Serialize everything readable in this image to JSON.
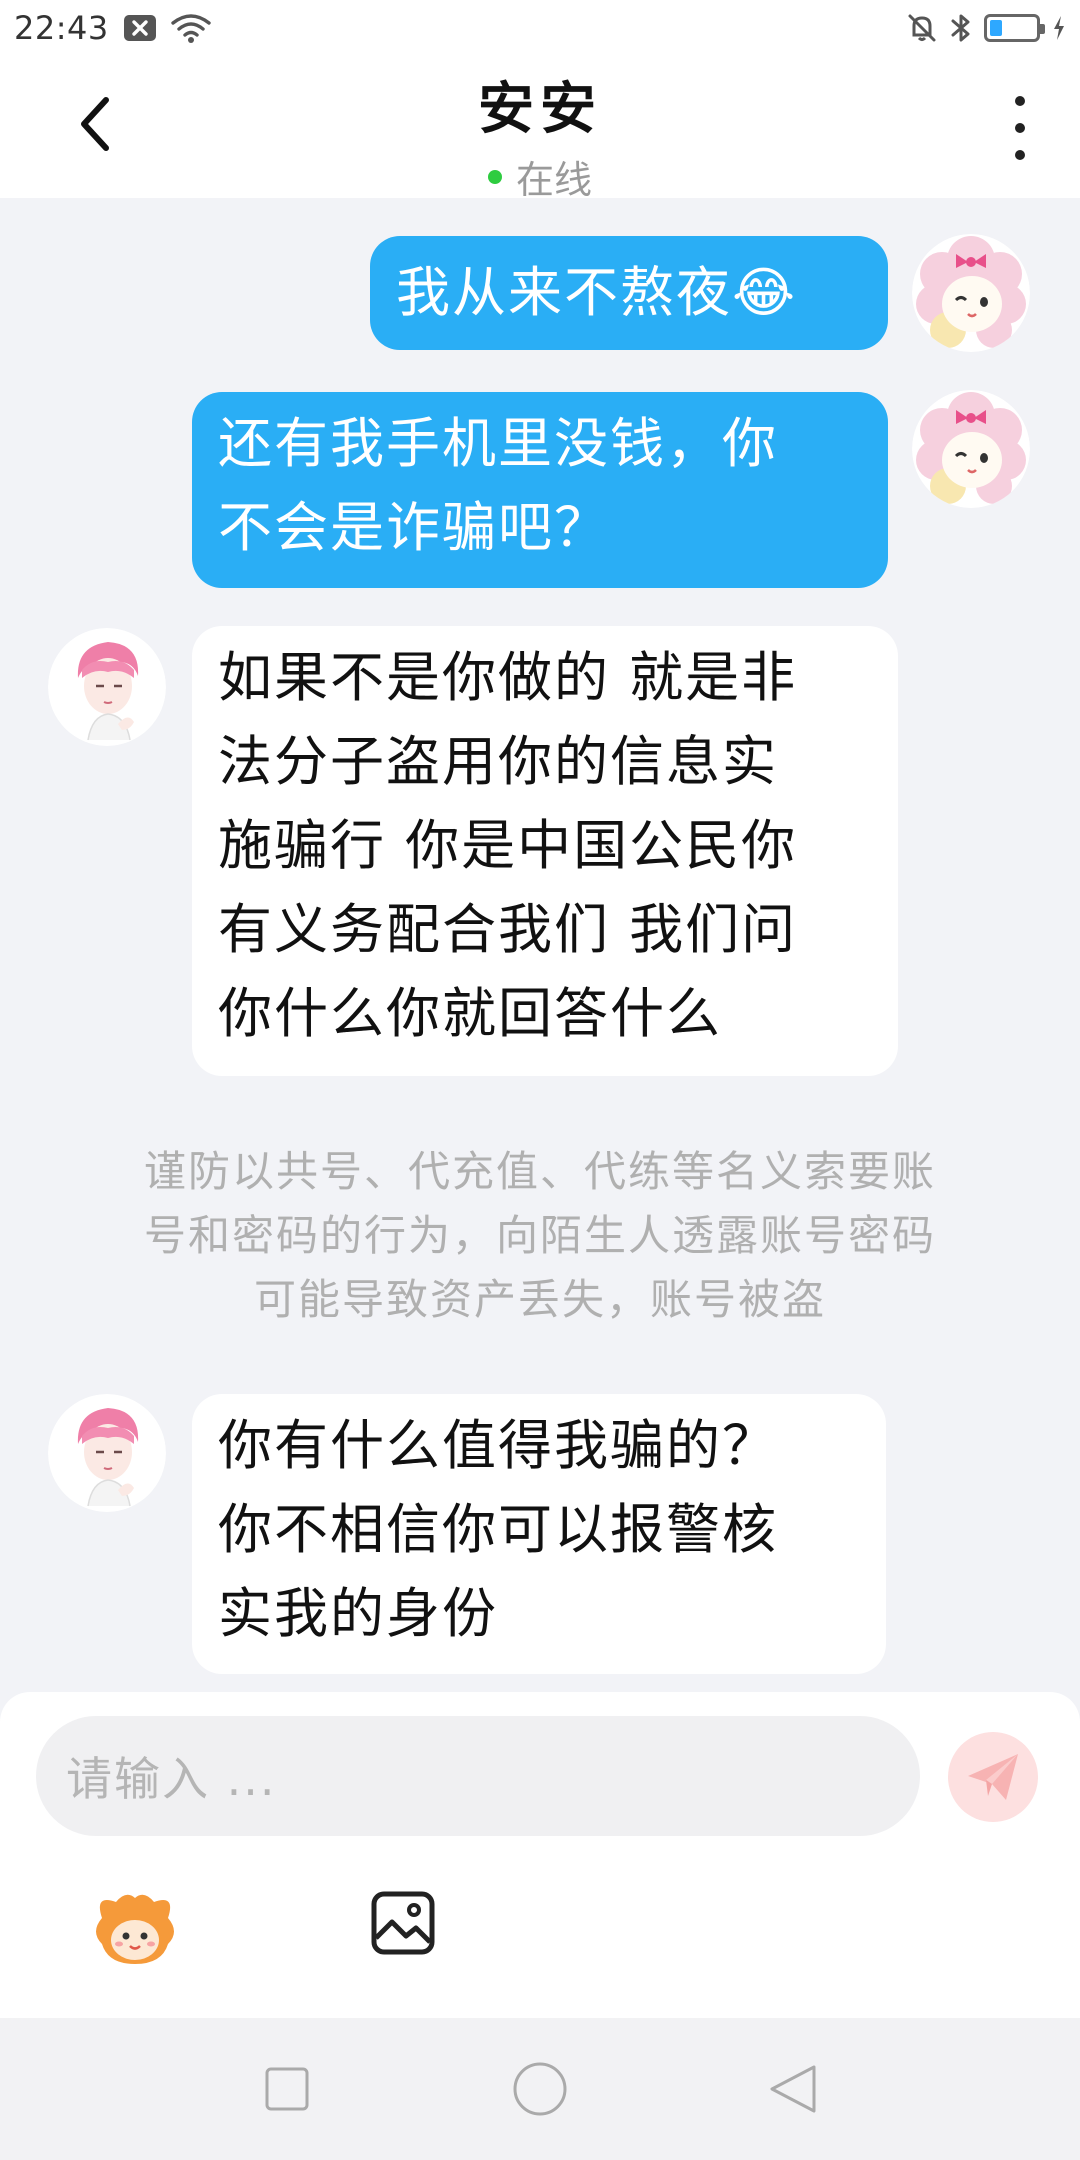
{
  "status_bar": {
    "time": "22:43"
  },
  "header": {
    "title": "安安",
    "presence": "在线"
  },
  "messages": [
    {
      "direction": "out",
      "text": "我从来不熬夜😂"
    },
    {
      "direction": "out",
      "lines": [
        "还有我手机里没钱，你",
        "不会是诈骗吧？"
      ]
    },
    {
      "direction": "in",
      "lines": [
        "如果不是你做的 就是非",
        "法分子盗用你的信息实",
        "施骗行 你是中国公民你",
        "有义务配合我们 我们问",
        "你什么你就回答什么"
      ]
    },
    {
      "direction": "in",
      "lines": [
        "你有什么值得我骗的？",
        "你不相信你可以报警核",
        "实我的身份"
      ]
    }
  ],
  "notice": {
    "lines": [
      "谨防以共号、代充值、代练等名义索要账",
      "号和密码的行为，向陌生人透露账号密码",
      "可能导致资产丢失，账号被盗"
    ]
  },
  "input": {
    "placeholder": "请输入 ..."
  },
  "colors": {
    "outgoing_bubble": "#2aaef5",
    "incoming_bubble": "#ffffff",
    "online_dot": "#2ecc40",
    "send_button_bg": "#fde0e0",
    "send_button_icon": "#f7b3b3"
  },
  "icons": {
    "back": "chevron-left-icon",
    "more": "vertical-dots-icon",
    "send": "paper-plane-icon",
    "emoji": "emoji-mascot-icon",
    "image": "image-icon",
    "nav_recent": "square-icon",
    "nav_home": "circle-icon",
    "nav_back": "triangle-icon"
  }
}
